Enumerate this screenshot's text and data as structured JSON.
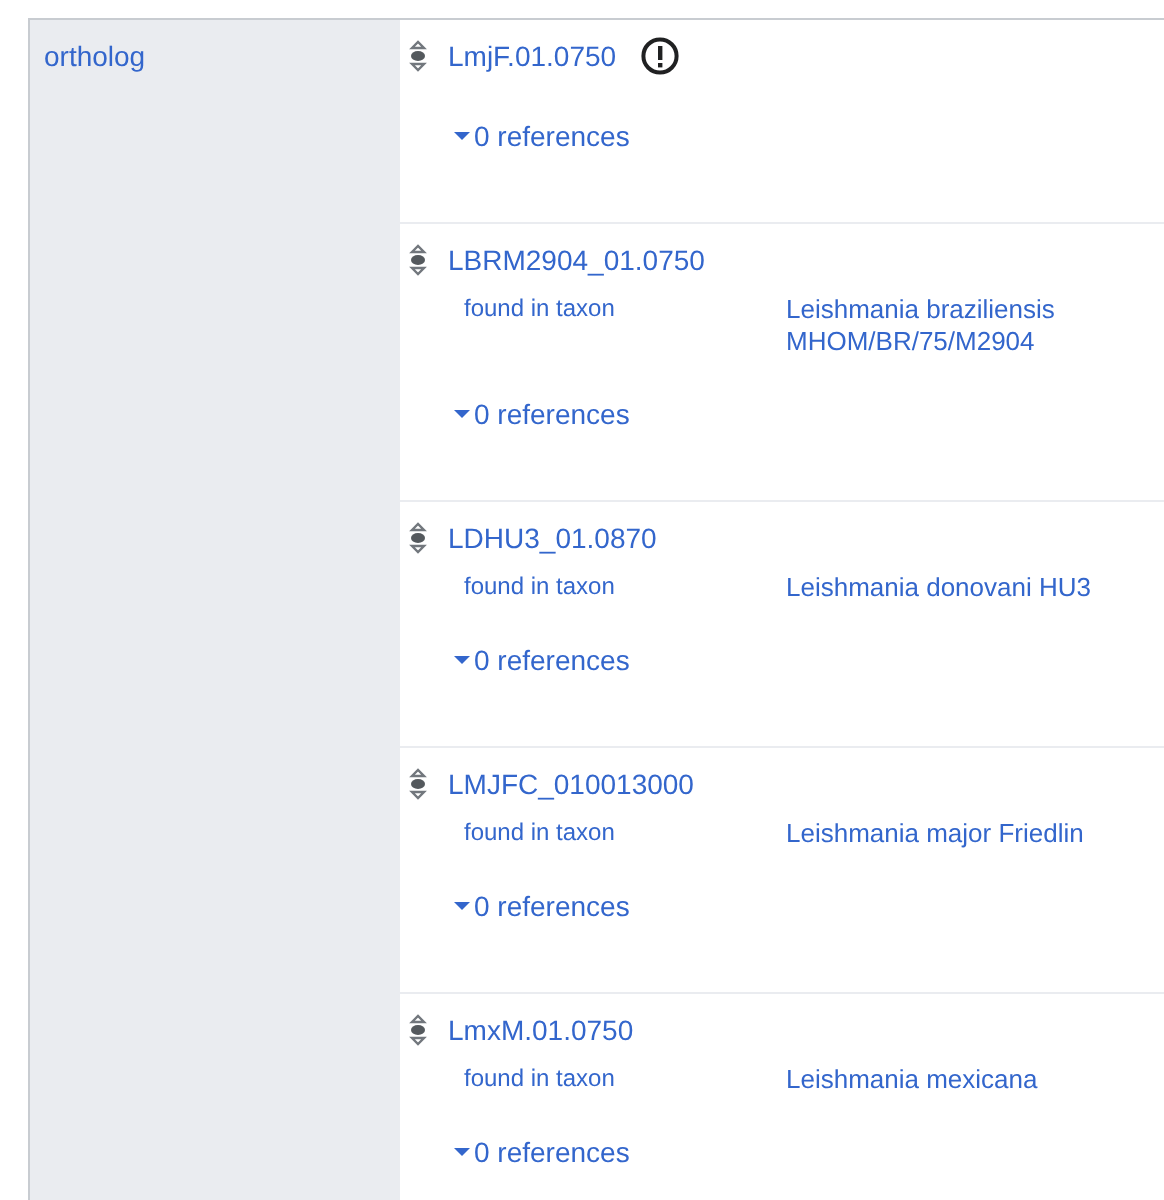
{
  "property": {
    "label": "ortholog"
  },
  "statements": [
    {
      "value": "LmjF.01.0750",
      "warning": true,
      "references": "0 references"
    },
    {
      "value": "LBRM2904_01.0750",
      "warning": false,
      "qualifiers": [
        {
          "property": "found in taxon",
          "value": "Leishmania braziliensis MHOM/BR/75/M2904"
        }
      ],
      "references": "0 references"
    },
    {
      "value": "LDHU3_01.0870",
      "warning": false,
      "qualifiers": [
        {
          "property": "found in taxon",
          "value": "Leishmania donovani HU3"
        }
      ],
      "references": "0 references"
    },
    {
      "value": "LMJFC_010013000",
      "warning": false,
      "qualifiers": [
        {
          "property": "found in taxon",
          "value": "Leishmania major Friedlin"
        }
      ],
      "references": "0 references"
    },
    {
      "value": "LmxM.01.0750",
      "warning": false,
      "qualifiers": [
        {
          "property": "found in taxon",
          "value": "Leishmania mexicana"
        }
      ],
      "references": "0 references"
    }
  ]
}
